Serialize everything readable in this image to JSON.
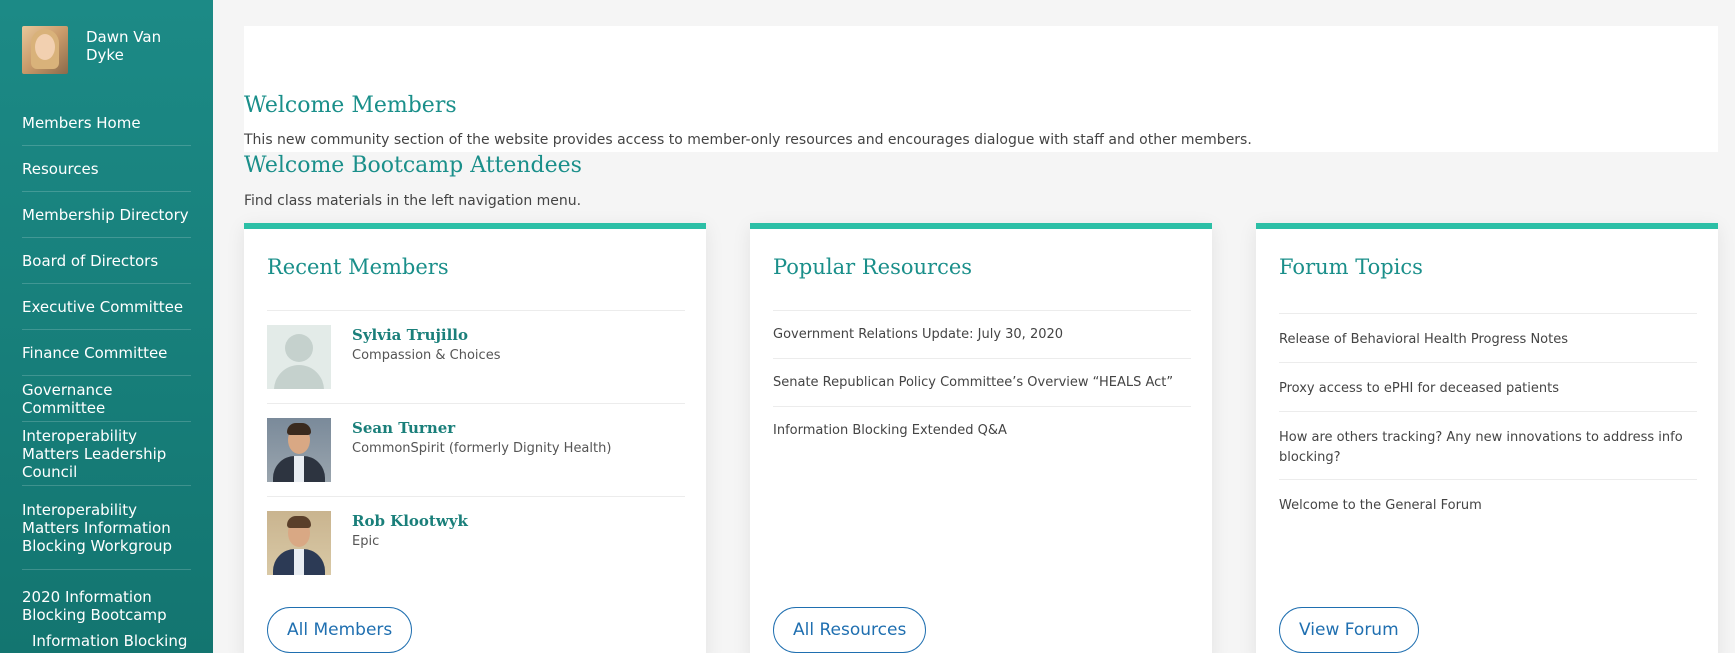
{
  "user": {
    "name": "Dawn Van Dyke"
  },
  "nav": {
    "items": [
      "Members Home",
      "Resources",
      "Membership Directory",
      "Board of Directors",
      "Executive Committee",
      "Finance Committee",
      "Governance Committee",
      "Interoperability Matters Leadership Council",
      "Interoperability Matters Information Blocking Workgroup",
      "2020 Information Blocking Bootcamp"
    ],
    "sub_item": "Information Blocking Bootcamp Resources"
  },
  "welcome": {
    "title": "Welcome Members",
    "text": "This new community section of the website provides access to member-only resources and encourages dialogue with staff and other members."
  },
  "bootcamp": {
    "title": "Welcome Bootcamp Attendees",
    "text": "Find class materials in the left navigation menu."
  },
  "recent_members": {
    "title": "Recent Members",
    "members": [
      {
        "name": "Sylvia Trujillo",
        "org": "Compassion & Choices"
      },
      {
        "name": "Sean Turner",
        "org": "CommonSpirit (formerly Dignity Health)"
      },
      {
        "name": "Rob Klootwyk",
        "org": "Epic"
      }
    ],
    "button": "All Members"
  },
  "popular_resources": {
    "title": "Popular Resources",
    "items": [
      "Government Relations Update: July 30, 2020",
      "Senate Republican Policy Committee’s Overview “HEALS Act”",
      " Information Blocking Extended Q&A"
    ],
    "button": "All Resources"
  },
  "forum_topics": {
    "title": "Forum Topics",
    "items": [
      "Release of Behavioral Health Progress Notes",
      "Proxy access to ePHI for deceased patients",
      "How are others tracking? Any new innovations to address info blocking?",
      "Welcome to the General Forum"
    ],
    "button": "View Forum"
  },
  "colors": {
    "sidebar": "#178079",
    "accent": "#1a8f8a",
    "card_border": "#2cbfa6",
    "button": "#1f6fb0"
  }
}
